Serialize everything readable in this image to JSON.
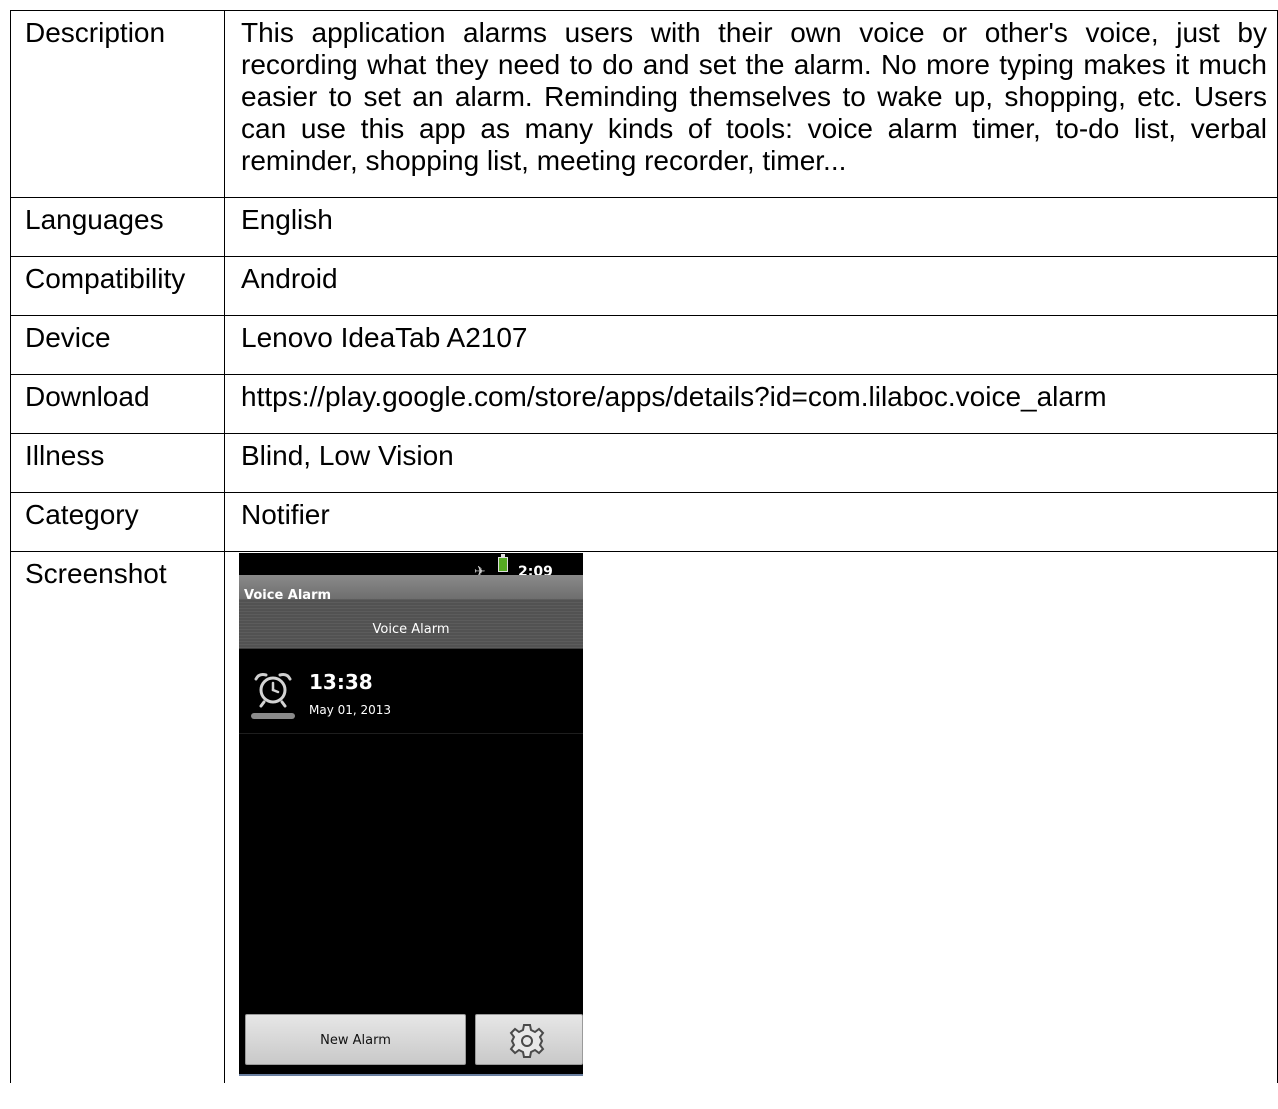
{
  "rows": [
    {
      "label": "Description",
      "value": "This application alarms users with their own voice or other's voice, just by recording what they need to do and set the alarm. No more typing makes it much easier to set an alarm. Reminding themselves to wake up, shopping, etc. Users can use this app as many kinds of tools: voice alarm timer, to-do list, verbal reminder, shopping list, meeting recorder, timer..."
    },
    {
      "label": "Languages",
      "value": "English"
    },
    {
      "label": "Compatibility",
      "value": "Android"
    },
    {
      "label": "Device",
      "value": "Lenovo IdeaTab A2107"
    },
    {
      "label": "Download",
      "value": "https://play.google.com/store/apps/details?id=com.lilaboc.voice_alarm"
    },
    {
      "label": "Illness",
      "value": "Blind, Low Vision"
    },
    {
      "label": "Category",
      "value": "Notifier"
    },
    {
      "label": "Screenshot"
    }
  ],
  "screenshot": {
    "status_time": "2:09",
    "status_icons": [
      "airplane-mode-icon",
      "battery-icon"
    ],
    "app_title": "Voice Alarm",
    "header": "Voice Alarm",
    "alarm": {
      "time": "13:38",
      "date": "May 01, 2013",
      "icon": "alarm-clock-icon"
    },
    "new_alarm_button": "New Alarm",
    "settings_icon": "gear-icon"
  }
}
